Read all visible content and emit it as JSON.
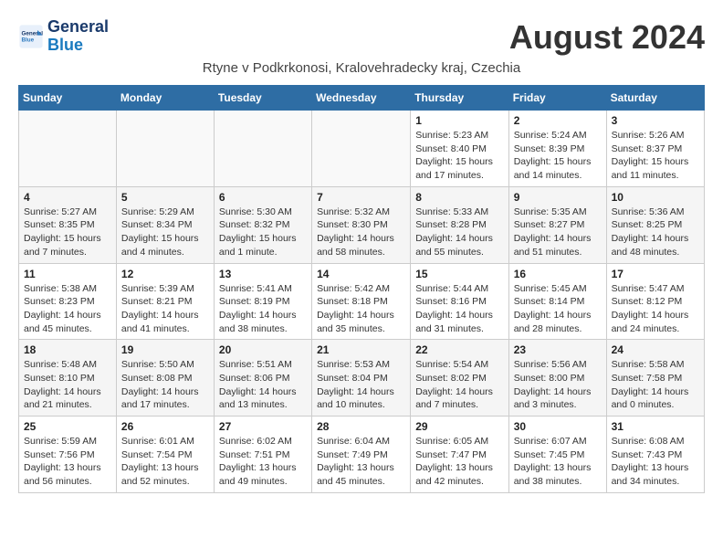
{
  "header": {
    "logo_general": "General",
    "logo_blue": "Blue",
    "month_title": "August 2024",
    "location": "Rtyne v Podkrkonosi, Kralovehradecky kraj, Czechia"
  },
  "calendar": {
    "days_of_week": [
      "Sunday",
      "Monday",
      "Tuesday",
      "Wednesday",
      "Thursday",
      "Friday",
      "Saturday"
    ],
    "weeks": [
      [
        {
          "day": "",
          "info": ""
        },
        {
          "day": "",
          "info": ""
        },
        {
          "day": "",
          "info": ""
        },
        {
          "day": "",
          "info": ""
        },
        {
          "day": "1",
          "info": "Sunrise: 5:23 AM\nSunset: 8:40 PM\nDaylight: 15 hours and 17 minutes."
        },
        {
          "day": "2",
          "info": "Sunrise: 5:24 AM\nSunset: 8:39 PM\nDaylight: 15 hours and 14 minutes."
        },
        {
          "day": "3",
          "info": "Sunrise: 5:26 AM\nSunset: 8:37 PM\nDaylight: 15 hours and 11 minutes."
        }
      ],
      [
        {
          "day": "4",
          "info": "Sunrise: 5:27 AM\nSunset: 8:35 PM\nDaylight: 15 hours and 7 minutes."
        },
        {
          "day": "5",
          "info": "Sunrise: 5:29 AM\nSunset: 8:34 PM\nDaylight: 15 hours and 4 minutes."
        },
        {
          "day": "6",
          "info": "Sunrise: 5:30 AM\nSunset: 8:32 PM\nDaylight: 15 hours and 1 minute."
        },
        {
          "day": "7",
          "info": "Sunrise: 5:32 AM\nSunset: 8:30 PM\nDaylight: 14 hours and 58 minutes."
        },
        {
          "day": "8",
          "info": "Sunrise: 5:33 AM\nSunset: 8:28 PM\nDaylight: 14 hours and 55 minutes."
        },
        {
          "day": "9",
          "info": "Sunrise: 5:35 AM\nSunset: 8:27 PM\nDaylight: 14 hours and 51 minutes."
        },
        {
          "day": "10",
          "info": "Sunrise: 5:36 AM\nSunset: 8:25 PM\nDaylight: 14 hours and 48 minutes."
        }
      ],
      [
        {
          "day": "11",
          "info": "Sunrise: 5:38 AM\nSunset: 8:23 PM\nDaylight: 14 hours and 45 minutes."
        },
        {
          "day": "12",
          "info": "Sunrise: 5:39 AM\nSunset: 8:21 PM\nDaylight: 14 hours and 41 minutes."
        },
        {
          "day": "13",
          "info": "Sunrise: 5:41 AM\nSunset: 8:19 PM\nDaylight: 14 hours and 38 minutes."
        },
        {
          "day": "14",
          "info": "Sunrise: 5:42 AM\nSunset: 8:18 PM\nDaylight: 14 hours and 35 minutes."
        },
        {
          "day": "15",
          "info": "Sunrise: 5:44 AM\nSunset: 8:16 PM\nDaylight: 14 hours and 31 minutes."
        },
        {
          "day": "16",
          "info": "Sunrise: 5:45 AM\nSunset: 8:14 PM\nDaylight: 14 hours and 28 minutes."
        },
        {
          "day": "17",
          "info": "Sunrise: 5:47 AM\nSunset: 8:12 PM\nDaylight: 14 hours and 24 minutes."
        }
      ],
      [
        {
          "day": "18",
          "info": "Sunrise: 5:48 AM\nSunset: 8:10 PM\nDaylight: 14 hours and 21 minutes."
        },
        {
          "day": "19",
          "info": "Sunrise: 5:50 AM\nSunset: 8:08 PM\nDaylight: 14 hours and 17 minutes."
        },
        {
          "day": "20",
          "info": "Sunrise: 5:51 AM\nSunset: 8:06 PM\nDaylight: 14 hours and 13 minutes."
        },
        {
          "day": "21",
          "info": "Sunrise: 5:53 AM\nSunset: 8:04 PM\nDaylight: 14 hours and 10 minutes."
        },
        {
          "day": "22",
          "info": "Sunrise: 5:54 AM\nSunset: 8:02 PM\nDaylight: 14 hours and 7 minutes."
        },
        {
          "day": "23",
          "info": "Sunrise: 5:56 AM\nSunset: 8:00 PM\nDaylight: 14 hours and 3 minutes."
        },
        {
          "day": "24",
          "info": "Sunrise: 5:58 AM\nSunset: 7:58 PM\nDaylight: 14 hours and 0 minutes."
        }
      ],
      [
        {
          "day": "25",
          "info": "Sunrise: 5:59 AM\nSunset: 7:56 PM\nDaylight: 13 hours and 56 minutes."
        },
        {
          "day": "26",
          "info": "Sunrise: 6:01 AM\nSunset: 7:54 PM\nDaylight: 13 hours and 52 minutes."
        },
        {
          "day": "27",
          "info": "Sunrise: 6:02 AM\nSunset: 7:51 PM\nDaylight: 13 hours and 49 minutes."
        },
        {
          "day": "28",
          "info": "Sunrise: 6:04 AM\nSunset: 7:49 PM\nDaylight: 13 hours and 45 minutes."
        },
        {
          "day": "29",
          "info": "Sunrise: 6:05 AM\nSunset: 7:47 PM\nDaylight: 13 hours and 42 minutes."
        },
        {
          "day": "30",
          "info": "Sunrise: 6:07 AM\nSunset: 7:45 PM\nDaylight: 13 hours and 38 minutes."
        },
        {
          "day": "31",
          "info": "Sunrise: 6:08 AM\nSunset: 7:43 PM\nDaylight: 13 hours and 34 minutes."
        }
      ]
    ]
  }
}
